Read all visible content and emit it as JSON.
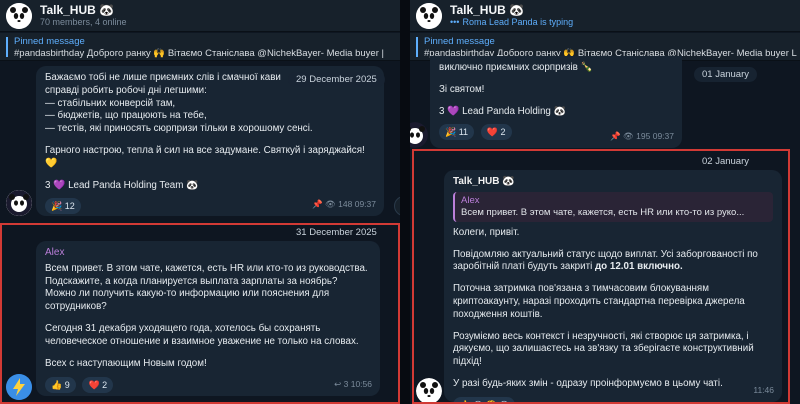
{
  "left": {
    "header": {
      "title": "Talk_HUB 🐼",
      "subtitle": "70 members, 4 online"
    },
    "pinned": {
      "label": "Pinned message",
      "text": "#pandasbirthday  Доброго ранку 🙌 Вітаємо Станіслава @NichekBayer- Media buyer  |"
    },
    "msg1": {
      "lines": [
        "Бажаємо тобі не лише приємних слів і смачної кави",
        "справді робить робочі дні легшими:",
        "— стабільних конверсій там,",
        "— бюджетів, що працюють на тебе,",
        "— тестів, які приносять сюрпризи тільки в хорошому сенсі."
      ],
      "line2": "Гарного настрою, тепла й сил на все задумане. Святкуй і заряджайся!",
      "emoji_line": "💛",
      "signature": "3 💜 Lead Panda Holding Team 🐼",
      "reaction": "🎉 12",
      "meta": "📌 👁 148 09:37",
      "date": "29 December 2025"
    },
    "date2": "31 December 2025",
    "msg2": {
      "sender": "Alex",
      "p1": "Всем привет. В этом чате, кажется, есть HR или кто-то из руководства. Подскажите, а когда планируется выплата зарплаты за ноябрь? Можно ли получить какую-то информацию или пояснения для сотрудников?",
      "p2": "Сегодня 31 декабря уходящего года, хотелось бы сохранять человеческое отношение и взаимное уважение не только на словах.",
      "p3": "Всех с наступающим Новым годом!",
      "reaction1": "👍 9",
      "reaction2": "❤️ 2",
      "meta": "↩ 3 10:56"
    }
  },
  "right": {
    "header": {
      "title": "Talk_HUB 🐼",
      "subtitle": "Roma Lead Panda is typing",
      "typing_prefix": "•••"
    },
    "pinned": {
      "label": "Pinned message",
      "text": "#pandasbirthday  Доброго ранку 🙌 Вітаємо Станіслава @NichekBayer- Media buyer  L"
    },
    "msg1": {
      "line1": "виключно приємних сюрпризів 🍾",
      "line2": "Зі святом!",
      "signature": "3 💜 Lead Panda Holding 🐼",
      "reaction1": "🎉 11",
      "reaction2": "❤️ 2",
      "meta": "📌 👁 195 09:37",
      "date": "01 January"
    },
    "date2": "02 January",
    "msg2": {
      "sender": "Talk_HUB 🐼",
      "quote_name": "Alex",
      "quote_text": "Всем привет. В этом чате, кажется, есть HR или кто-то из руко...",
      "greeting": "Колеги, привіт.",
      "p1_a": "Повідомляю актуальний статус щодо виплат. Усі заборгованості по заробітній платі будуть закриті ",
      "p1_b": "до 12.01 включно.",
      "p2": "Поточна затримка пов'язана з тимчасовим блокуванням криптоакаунту, наразі проходить стандартна перевірка джерела походження коштів.",
      "p3": "Розуміємо весь контекст і незручності, які створює ця затримка, і дякуємо, що залишаєтесь на зв'язку та зберігаєте конструктивний підхід!",
      "p4": "У разі будь-яких змін - одразу проінформуємо в цьому чаті.",
      "reactions": "👍 😂 🤔 😐",
      "meta": "11:46"
    }
  },
  "colors": {
    "accent": "#5eaefc",
    "highlight": "#d23a35",
    "bubble": "#182533",
    "background": "#0e1621"
  }
}
